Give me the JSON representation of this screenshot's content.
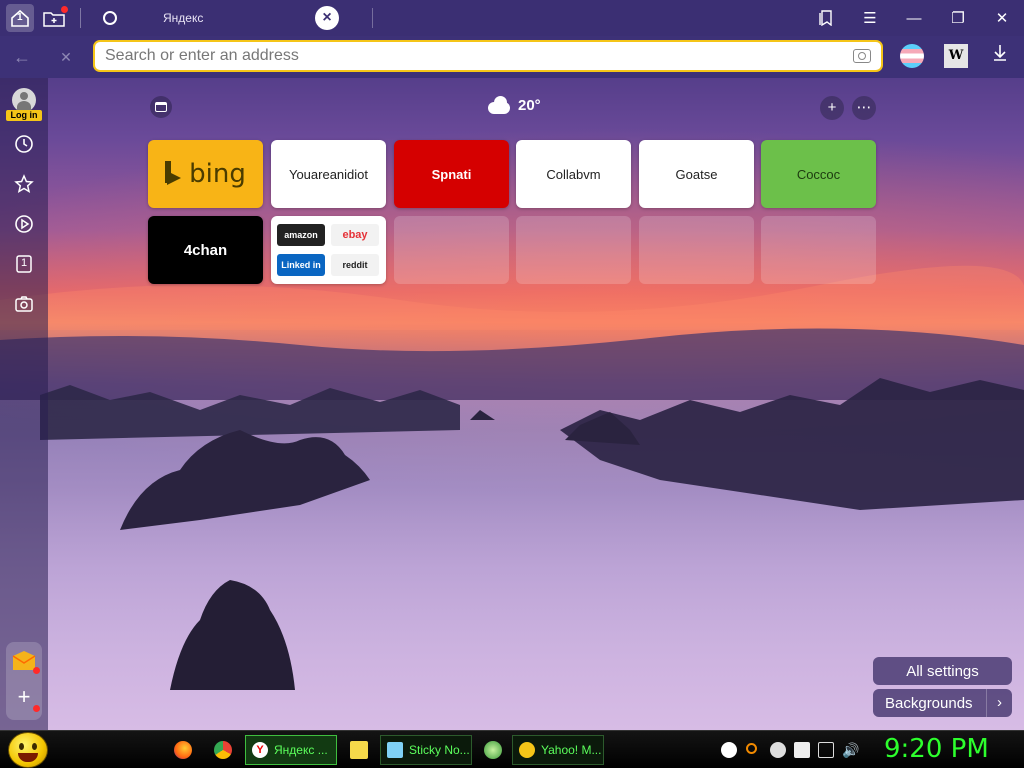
{
  "titlebar": {
    "home_tab_count": "1",
    "tab": {
      "title": "Яндекс"
    }
  },
  "address": {
    "placeholder": "Search or enter an address"
  },
  "sidebar": {
    "login_label": "Log in",
    "tabs_count": "1"
  },
  "widgets": {
    "weather_temp": "20°"
  },
  "tiles": [
    {
      "label": "bing",
      "kind": "bing"
    },
    {
      "label": "Youareanidiot",
      "kind": "plain"
    },
    {
      "label": "Spnati",
      "kind": "spnati"
    },
    {
      "label": "Collabvm",
      "kind": "plain"
    },
    {
      "label": "Goatse",
      "kind": "plain"
    },
    {
      "label": "Coccoc",
      "kind": "coccoc"
    },
    {
      "label": "4chan",
      "kind": "fourchan"
    }
  ],
  "multi_tile": {
    "amazon": "amazon",
    "ebay": "ebay",
    "linkedin": "Linked in",
    "reddit": "reddit"
  },
  "bottom_right": {
    "all_settings": "All settings",
    "backgrounds": "Backgrounds"
  },
  "taskbar": {
    "tasks": [
      {
        "label": "Яндекс ..."
      },
      {
        "label": "Sticky No..."
      },
      {
        "label": "Yahoo! M..."
      }
    ],
    "clock": "9:20 PM"
  },
  "colors": {
    "accent_yellow": "#f5c518",
    "titlebar": "#3b2f73",
    "clock_green": "#2dff2d",
    "bing_tile": "#f8b416",
    "spnati_tile": "#d50000",
    "coccoc_tile": "#6cc04a"
  }
}
